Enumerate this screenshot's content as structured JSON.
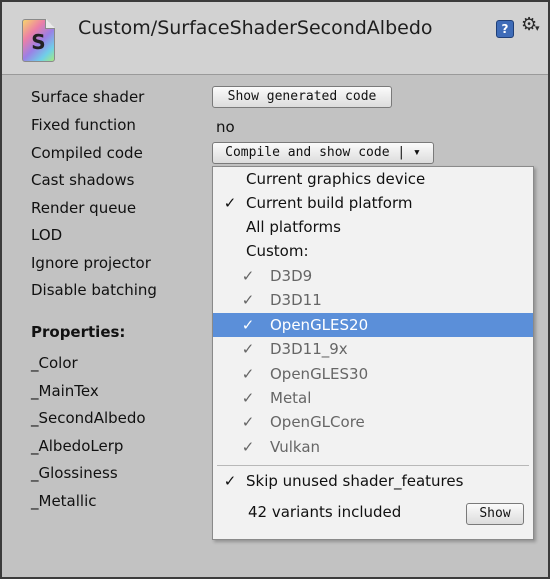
{
  "header": {
    "title": "Custom/SurfaceShaderSecondAlbedo",
    "icon_letter": "S",
    "help_glyph": "?",
    "gear_glyph": "⚙",
    "gear_caret": "▾"
  },
  "fields": {
    "surface_shader_label": "Surface shader",
    "show_generated_code_button": "Show generated code",
    "fixed_function_label": "Fixed function",
    "fixed_function_value": "no",
    "compiled_code_label": "Compiled code",
    "compile_button": "Compile and show code | ▾",
    "cast_shadows_label": "Cast shadows",
    "render_queue_label": "Render queue",
    "lod_label": "LOD",
    "ignore_projector_label": "Ignore projector",
    "disable_batching_label": "Disable batching"
  },
  "properties": {
    "heading": "Properties:",
    "items": [
      "_Color",
      "_MainTex",
      "_SecondAlbedo",
      "_AlbedoLerp",
      "_Glossiness",
      "_Metallic"
    ]
  },
  "dropdown": {
    "items": [
      {
        "label": "Current graphics device",
        "checked": false,
        "level": "top",
        "state": "normal"
      },
      {
        "label": "Current build platform",
        "checked": true,
        "level": "top",
        "state": "normal"
      },
      {
        "label": "All platforms",
        "checked": false,
        "level": "top",
        "state": "normal"
      },
      {
        "label": "Custom:",
        "checked": false,
        "level": "top",
        "state": "normal"
      },
      {
        "label": "D3D9",
        "checked": true,
        "level": "sub",
        "state": "disabled"
      },
      {
        "label": "D3D11",
        "checked": true,
        "level": "sub",
        "state": "disabled"
      },
      {
        "label": "OpenGLES20",
        "checked": true,
        "level": "sub",
        "state": "selected"
      },
      {
        "label": "D3D11_9x",
        "checked": true,
        "level": "sub",
        "state": "disabled"
      },
      {
        "label": "OpenGLES30",
        "checked": true,
        "level": "sub",
        "state": "disabled"
      },
      {
        "label": "Metal",
        "checked": true,
        "level": "sub",
        "state": "disabled"
      },
      {
        "label": "OpenGLCore",
        "checked": true,
        "level": "sub",
        "state": "disabled"
      },
      {
        "label": "Vulkan",
        "checked": true,
        "level": "sub",
        "state": "disabled"
      }
    ],
    "check_glyph": "✓",
    "skip_unused_label": "Skip unused shader_features",
    "skip_unused_checked": true,
    "variants_text": "42 variants included",
    "show_button": "Show"
  },
  "colors": {
    "selection": "#5b8fd9",
    "panel": "#c2c2c2",
    "menu_background": "#f2f2f2"
  }
}
